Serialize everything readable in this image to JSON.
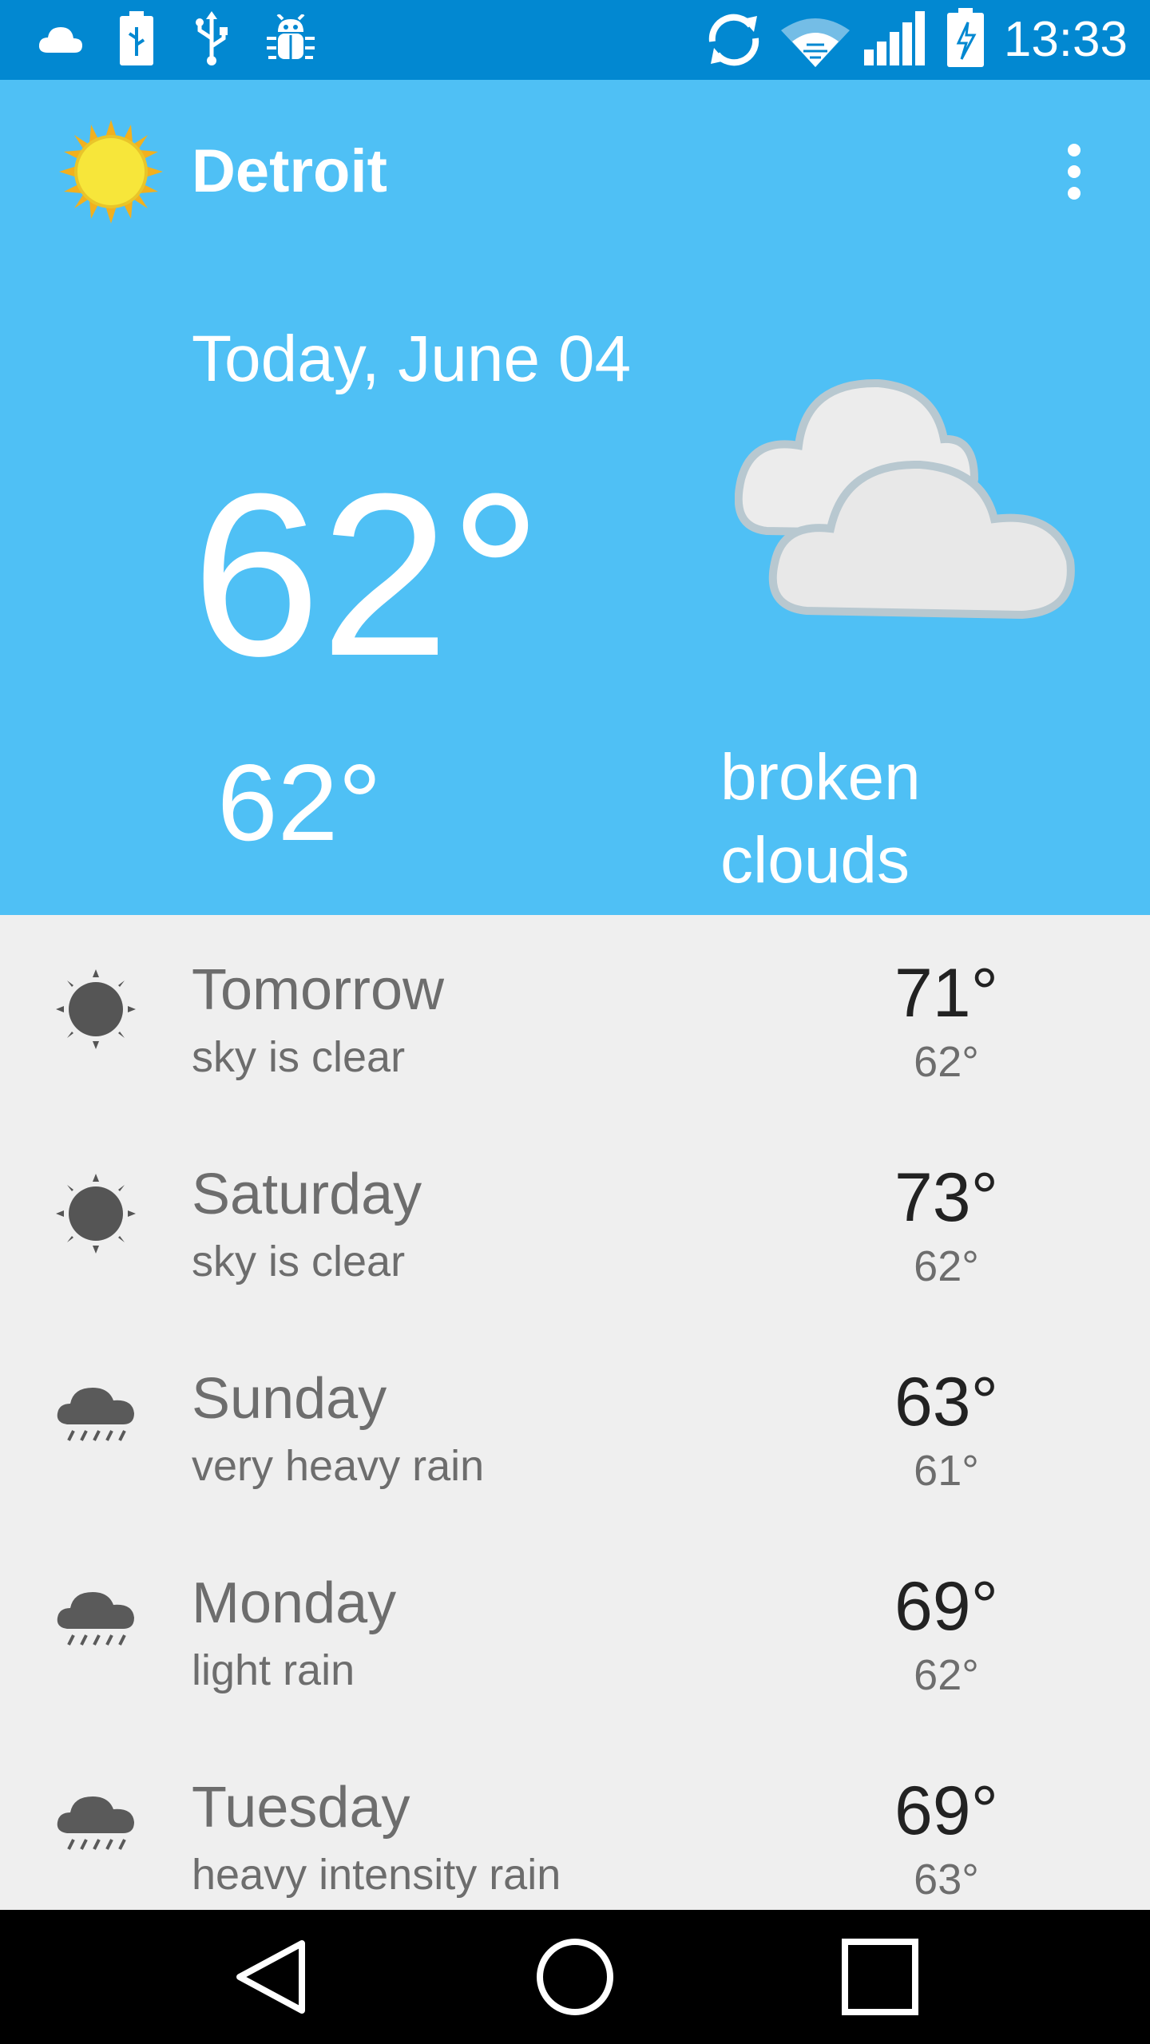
{
  "status_bar": {
    "time": "13:33",
    "left_icons": [
      "cloud-icon",
      "battery-usb-icon",
      "usb-icon",
      "android-debug-icon"
    ],
    "right_icons": [
      "sync-icon",
      "wifi-icon",
      "signal-icon",
      "battery-charging-icon"
    ]
  },
  "header": {
    "city": "Detroit",
    "logo_icon": "sun-icon",
    "menu_icon": "overflow-menu-icon"
  },
  "today": {
    "date": "Today, June 04",
    "high": "62°",
    "low": "62°",
    "description": "broken\nclouds",
    "icon": "broken-clouds-icon"
  },
  "forecast": [
    {
      "day": "Tomorrow",
      "condition": "sky is clear",
      "high": "71°",
      "low": "62°",
      "icon": "clear-sky-icon"
    },
    {
      "day": "Saturday",
      "condition": "sky is clear",
      "high": "73°",
      "low": "62°",
      "icon": "clear-sky-icon"
    },
    {
      "day": "Sunday",
      "condition": "very heavy rain",
      "high": "63°",
      "low": "61°",
      "icon": "rain-icon"
    },
    {
      "day": "Monday",
      "condition": "light rain",
      "high": "69°",
      "low": "62°",
      "icon": "rain-icon"
    },
    {
      "day": "Tuesday",
      "condition": "heavy intensity rain",
      "high": "69°",
      "low": "63°",
      "icon": "rain-icon"
    }
  ],
  "nav_bar": [
    "back-icon",
    "home-icon",
    "recents-icon"
  ],
  "colors": {
    "status_bar": "#0288d1",
    "hero": "#4fc0f5",
    "list_bg": "#efefef",
    "nav_bar": "#000000"
  }
}
